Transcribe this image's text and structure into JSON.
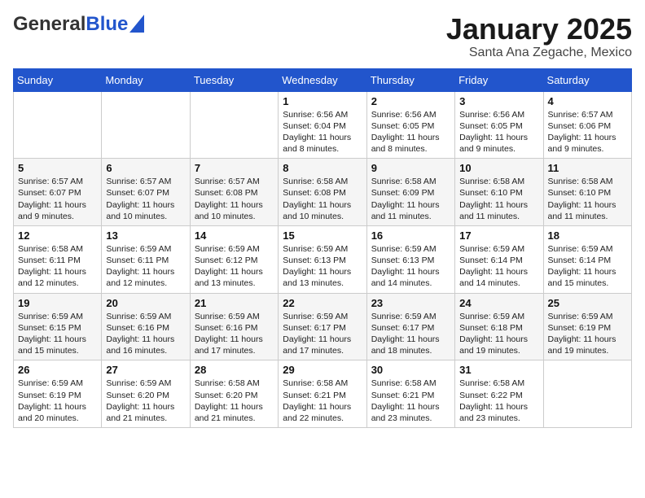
{
  "header": {
    "logo_general": "General",
    "logo_blue": "Blue",
    "month_title": "January 2025",
    "location": "Santa Ana Zegache, Mexico"
  },
  "weekdays": [
    "Sunday",
    "Monday",
    "Tuesday",
    "Wednesday",
    "Thursday",
    "Friday",
    "Saturday"
  ],
  "weeks": [
    [
      {
        "day": "",
        "info": ""
      },
      {
        "day": "",
        "info": ""
      },
      {
        "day": "",
        "info": ""
      },
      {
        "day": "1",
        "info": "Sunrise: 6:56 AM\nSunset: 6:04 PM\nDaylight: 11 hours and 8 minutes."
      },
      {
        "day": "2",
        "info": "Sunrise: 6:56 AM\nSunset: 6:05 PM\nDaylight: 11 hours and 8 minutes."
      },
      {
        "day": "3",
        "info": "Sunrise: 6:56 AM\nSunset: 6:05 PM\nDaylight: 11 hours and 9 minutes."
      },
      {
        "day": "4",
        "info": "Sunrise: 6:57 AM\nSunset: 6:06 PM\nDaylight: 11 hours and 9 minutes."
      }
    ],
    [
      {
        "day": "5",
        "info": "Sunrise: 6:57 AM\nSunset: 6:07 PM\nDaylight: 11 hours and 9 minutes."
      },
      {
        "day": "6",
        "info": "Sunrise: 6:57 AM\nSunset: 6:07 PM\nDaylight: 11 hours and 10 minutes."
      },
      {
        "day": "7",
        "info": "Sunrise: 6:57 AM\nSunset: 6:08 PM\nDaylight: 11 hours and 10 minutes."
      },
      {
        "day": "8",
        "info": "Sunrise: 6:58 AM\nSunset: 6:08 PM\nDaylight: 11 hours and 10 minutes."
      },
      {
        "day": "9",
        "info": "Sunrise: 6:58 AM\nSunset: 6:09 PM\nDaylight: 11 hours and 11 minutes."
      },
      {
        "day": "10",
        "info": "Sunrise: 6:58 AM\nSunset: 6:10 PM\nDaylight: 11 hours and 11 minutes."
      },
      {
        "day": "11",
        "info": "Sunrise: 6:58 AM\nSunset: 6:10 PM\nDaylight: 11 hours and 11 minutes."
      }
    ],
    [
      {
        "day": "12",
        "info": "Sunrise: 6:58 AM\nSunset: 6:11 PM\nDaylight: 11 hours and 12 minutes."
      },
      {
        "day": "13",
        "info": "Sunrise: 6:59 AM\nSunset: 6:11 PM\nDaylight: 11 hours and 12 minutes."
      },
      {
        "day": "14",
        "info": "Sunrise: 6:59 AM\nSunset: 6:12 PM\nDaylight: 11 hours and 13 minutes."
      },
      {
        "day": "15",
        "info": "Sunrise: 6:59 AM\nSunset: 6:13 PM\nDaylight: 11 hours and 13 minutes."
      },
      {
        "day": "16",
        "info": "Sunrise: 6:59 AM\nSunset: 6:13 PM\nDaylight: 11 hours and 14 minutes."
      },
      {
        "day": "17",
        "info": "Sunrise: 6:59 AM\nSunset: 6:14 PM\nDaylight: 11 hours and 14 minutes."
      },
      {
        "day": "18",
        "info": "Sunrise: 6:59 AM\nSunset: 6:14 PM\nDaylight: 11 hours and 15 minutes."
      }
    ],
    [
      {
        "day": "19",
        "info": "Sunrise: 6:59 AM\nSunset: 6:15 PM\nDaylight: 11 hours and 15 minutes."
      },
      {
        "day": "20",
        "info": "Sunrise: 6:59 AM\nSunset: 6:16 PM\nDaylight: 11 hours and 16 minutes."
      },
      {
        "day": "21",
        "info": "Sunrise: 6:59 AM\nSunset: 6:16 PM\nDaylight: 11 hours and 17 minutes."
      },
      {
        "day": "22",
        "info": "Sunrise: 6:59 AM\nSunset: 6:17 PM\nDaylight: 11 hours and 17 minutes."
      },
      {
        "day": "23",
        "info": "Sunrise: 6:59 AM\nSunset: 6:17 PM\nDaylight: 11 hours and 18 minutes."
      },
      {
        "day": "24",
        "info": "Sunrise: 6:59 AM\nSunset: 6:18 PM\nDaylight: 11 hours and 19 minutes."
      },
      {
        "day": "25",
        "info": "Sunrise: 6:59 AM\nSunset: 6:19 PM\nDaylight: 11 hours and 19 minutes."
      }
    ],
    [
      {
        "day": "26",
        "info": "Sunrise: 6:59 AM\nSunset: 6:19 PM\nDaylight: 11 hours and 20 minutes."
      },
      {
        "day": "27",
        "info": "Sunrise: 6:59 AM\nSunset: 6:20 PM\nDaylight: 11 hours and 21 minutes."
      },
      {
        "day": "28",
        "info": "Sunrise: 6:58 AM\nSunset: 6:20 PM\nDaylight: 11 hours and 21 minutes."
      },
      {
        "day": "29",
        "info": "Sunrise: 6:58 AM\nSunset: 6:21 PM\nDaylight: 11 hours and 22 minutes."
      },
      {
        "day": "30",
        "info": "Sunrise: 6:58 AM\nSunset: 6:21 PM\nDaylight: 11 hours and 23 minutes."
      },
      {
        "day": "31",
        "info": "Sunrise: 6:58 AM\nSunset: 6:22 PM\nDaylight: 11 hours and 23 minutes."
      },
      {
        "day": "",
        "info": ""
      }
    ]
  ]
}
